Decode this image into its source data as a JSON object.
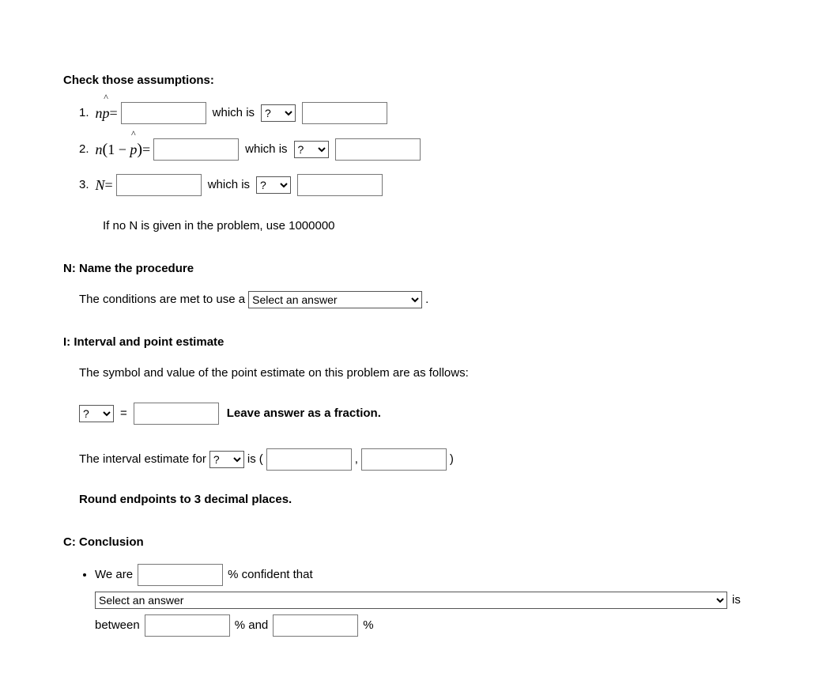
{
  "check": {
    "title": "Check those assumptions:",
    "r1": {
      "num": "1.",
      "label": "np̂=",
      "n": "n",
      "p": "p",
      "eq": "=",
      "which": "which is",
      "opt": "?"
    },
    "r2": {
      "num": "2.",
      "n": "n",
      "open": "(",
      "one": "1",
      "minus": "−",
      "p": "p",
      "close": ")",
      "eq": "=",
      "which": "which is",
      "opt": "?"
    },
    "r3": {
      "num": "3.",
      "N": "N",
      "eq": "=",
      "which": "which is",
      "opt": "?"
    },
    "note": "If no N is given in the problem, use 1000000"
  },
  "n_section": {
    "title": "N: Name the procedure",
    "line1a": "The conditions are met to use a",
    "select": "Select an answer",
    "dot": "."
  },
  "i_section": {
    "title": "I: Interval and point estimate",
    "line1": "The symbol and value of the point estimate on this problem are as follows:",
    "opt": "?",
    "eq": "=",
    "leave": "Leave answer as a fraction.",
    "line2a": "The interval estimate for",
    "opt2": "?",
    "is": "is",
    "open": "(",
    "comma": ",",
    "close": ")",
    "round": "Round endpoints to 3 decimal places."
  },
  "c_section": {
    "title": "C: Conclusion",
    "we": "We are",
    "pct_conf": "% confident that",
    "select": "Select an answer",
    "is": "is",
    "between": "between",
    "pct_and": "% and",
    "pct": "%"
  }
}
